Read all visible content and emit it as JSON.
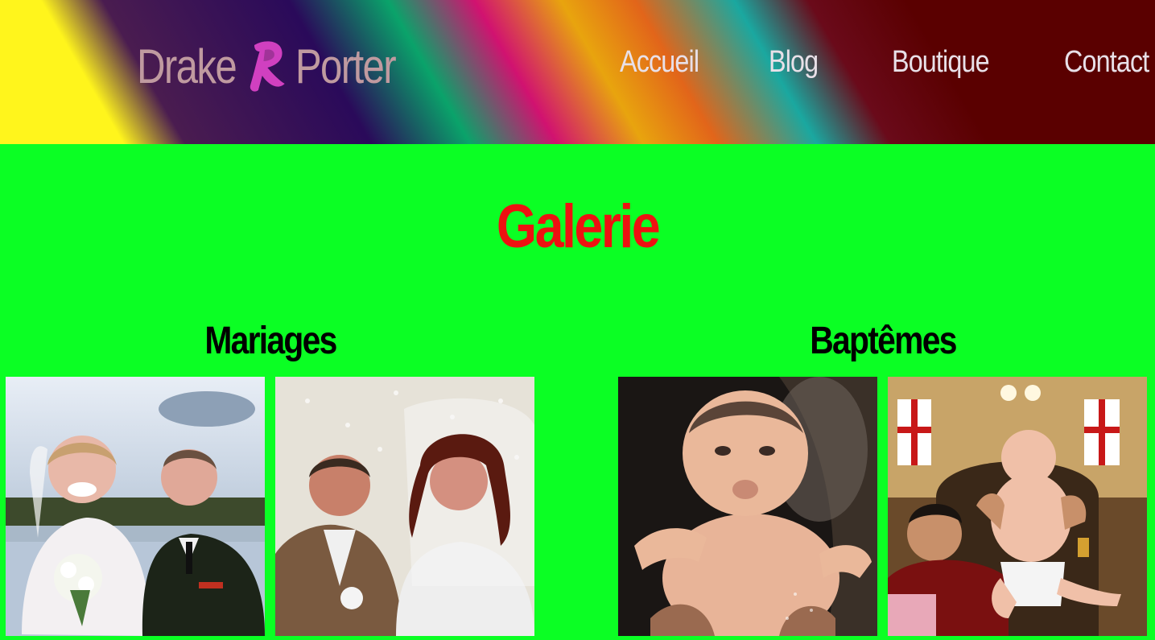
{
  "header": {
    "logo_left": "Drake",
    "logo_right": "Porter",
    "logo_icon": "stylized-r-brush-icon"
  },
  "nav": {
    "items": [
      {
        "label": "Accueil"
      },
      {
        "label": "Blog"
      },
      {
        "label": "Boutique"
      },
      {
        "label": "Contact"
      }
    ]
  },
  "main": {
    "title": "Galerie",
    "sections": [
      {
        "title": "Mariages",
        "photos": [
          "wedding-couple-1-photo",
          "wedding-couple-2-photo"
        ]
      },
      {
        "title": "Baptêmes",
        "photos": [
          "baptism-baby-1-photo",
          "baptism-baby-2-photo"
        ]
      }
    ]
  },
  "colors": {
    "page_background": "#0bff24",
    "title": "#ee1111",
    "logo_text": "#c09aa0",
    "logo_mark": "#d040c0",
    "nav_text": "#e8e0e8"
  }
}
